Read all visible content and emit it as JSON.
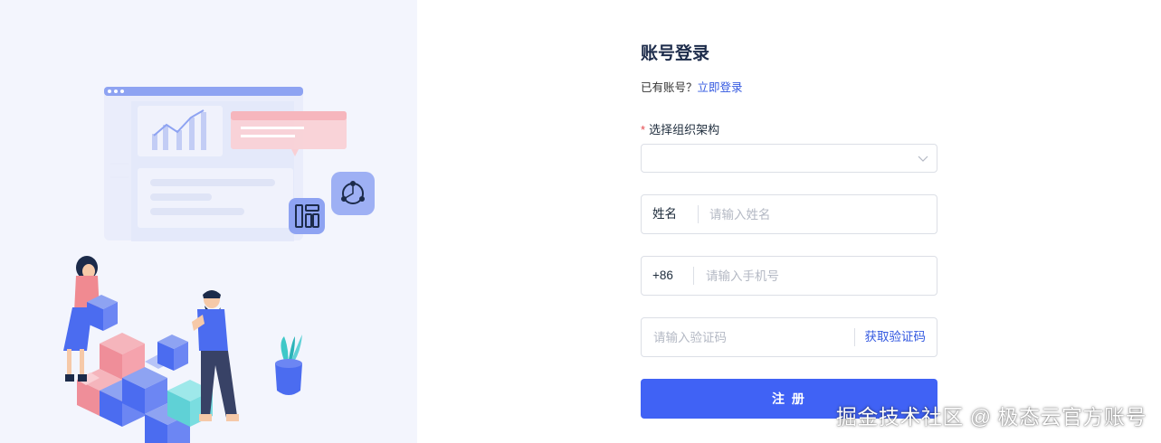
{
  "register": {
    "title": "账号登录",
    "has_account_text": "已有账号？",
    "login_link": "立即登录",
    "org": {
      "required_mark": "*",
      "label": "选择组织架构",
      "value": ""
    },
    "name": {
      "prefix": "姓名",
      "placeholder": "请输入姓名"
    },
    "phone": {
      "prefix": "+86",
      "placeholder": "请输入手机号"
    },
    "code": {
      "placeholder": "请输入验证码",
      "get_code": "获取验证码"
    },
    "submit": "注 册"
  },
  "watermark": "掘金技术社区 @ 极态云官方账号",
  "colors": {
    "accent": "#4062f5",
    "link": "#3358e0",
    "required": "#e5484d",
    "left_panel_bg": "#f3f5fd"
  },
  "icons": {
    "org_select": "chevron-down-icon"
  }
}
